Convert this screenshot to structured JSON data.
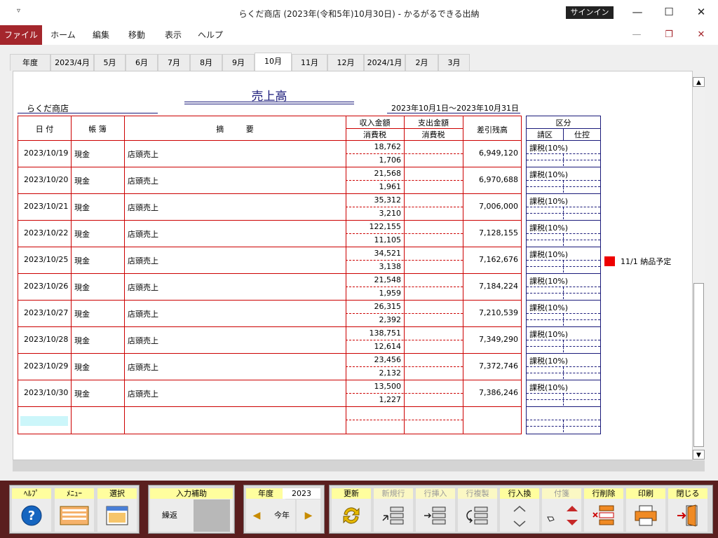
{
  "window": {
    "quick_access": "▿",
    "title": "らくだ商店 (2023年(令和5年)10月30日)  -  かるがるできる出納",
    "sign_in": "サインイン",
    "minimize": "—",
    "maximize": "☐",
    "close": "✕"
  },
  "ribbon": {
    "tabs": [
      "ファイル",
      "ホーム",
      "編集",
      "移動",
      "表示",
      "ヘルプ"
    ],
    "ctl_min": "—",
    "ctl_restore": "❐",
    "ctl_close": "✕"
  },
  "month_tabs": [
    "年度",
    "2023/4月",
    "5月",
    "6月",
    "7月",
    "8月",
    "9月",
    "10月",
    "11月",
    "12月",
    "2024/1月",
    "2月",
    "3月"
  ],
  "active_month": "10月",
  "report": {
    "title": "売上高",
    "shop": "らくだ商店",
    "period": "2023年10月1日～2023年10月31日"
  },
  "headers": {
    "date": "日 付",
    "book": "帳 簿",
    "summary": "摘 要",
    "income": "収入金額",
    "income_tax": "消費税",
    "expense": "支出金額",
    "expense_tax": "消費税",
    "balance": "差引残高",
    "category": "区分",
    "cat_sales": "請区",
    "cat_purchase": "仕控"
  },
  "rows": [
    {
      "date": "2023/10/19",
      "book": "現金",
      "summary": "店頭売上",
      "income": "18,762",
      "tax": "1,706",
      "balance": "6,949,120",
      "category": "課税(10%)"
    },
    {
      "date": "2023/10/20",
      "book": "現金",
      "summary": "店頭売上",
      "income": "21,568",
      "tax": "1,961",
      "balance": "6,970,688",
      "category": "課税(10%)"
    },
    {
      "date": "2023/10/21",
      "book": "現金",
      "summary": "店頭売上",
      "income": "35,312",
      "tax": "3,210",
      "balance": "7,006,000",
      "category": "課税(10%)"
    },
    {
      "date": "2023/10/22",
      "book": "現金",
      "summary": "店頭売上",
      "income": "122,155",
      "tax": "11,105",
      "balance": "7,128,155",
      "category": "課税(10%)"
    },
    {
      "date": "2023/10/25",
      "book": "現金",
      "summary": "店頭売上",
      "income": "34,521",
      "tax": "3,138",
      "balance": "7,162,676",
      "category": "課税(10%)"
    },
    {
      "date": "2023/10/26",
      "book": "現金",
      "summary": "店頭売上",
      "income": "21,548",
      "tax": "1,959",
      "balance": "7,184,224",
      "category": "課税(10%)"
    },
    {
      "date": "2023/10/27",
      "book": "現金",
      "summary": "店頭売上",
      "income": "26,315",
      "tax": "2,392",
      "balance": "7,210,539",
      "category": "課税(10%)"
    },
    {
      "date": "2023/10/28",
      "book": "現金",
      "summary": "店頭売上",
      "income": "138,751",
      "tax": "12,614",
      "balance": "7,349,290",
      "category": "課税(10%)"
    },
    {
      "date": "2023/10/29",
      "book": "現金",
      "summary": "店頭売上",
      "income": "23,456",
      "tax": "2,132",
      "balance": "7,372,746",
      "category": "課税(10%)"
    },
    {
      "date": "2023/10/30",
      "book": "現金",
      "summary": "店頭売上",
      "income": "13,500",
      "tax": "1,227",
      "balance": "7,386,246",
      "category": "課税(10%)"
    }
  ],
  "note": {
    "color": "#ee0000",
    "text": "11/1  納品予定"
  },
  "scrollbar": {
    "up": "▲",
    "down": "▼"
  },
  "toolbar": {
    "help": "ﾍﾙﾌﾟ",
    "menu": "ﾒﾆｭｰ",
    "select": "選択",
    "input_assist": "入力補助",
    "repeat": "繰返",
    "year_label": "年度",
    "year_value": "2023",
    "prev": "◀",
    "this_year": "今年",
    "next": "▶",
    "update": "更新",
    "new_row": "新規行",
    "insert_row": "行挿入",
    "copy_row": "行複製",
    "swap_row": "行入換",
    "sticky": "付箋",
    "delete_row": "行削除",
    "print": "印刷",
    "close": "閉じる"
  },
  "icons": {
    "help": "question-circle-icon",
    "menu": "menu-list-icon",
    "select": "calendar-grid-icon",
    "update": "refresh-icon",
    "new_row": "new-row-icon",
    "insert_row": "insert-row-icon",
    "copy_row": "copy-row-icon",
    "swap_row": "swap-row-icon",
    "sticky": "sticky-note-icon",
    "delete_row": "delete-row-icon",
    "print": "printer-icon",
    "close": "exit-door-icon"
  }
}
